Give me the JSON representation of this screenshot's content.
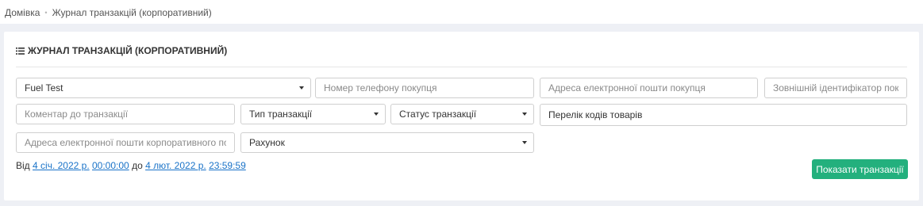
{
  "breadcrumb": {
    "home": "Домівка",
    "separator": "•",
    "current": "Журнал транзакцій (корпоративний)"
  },
  "panel": {
    "title": "ЖУРНАЛ ТРАНЗАКЦІЙ (КОРПОРАТИВНИЙ)",
    "title_icon": "list-icon"
  },
  "filters": {
    "account_select": {
      "value": "Fuel Test"
    },
    "buyer_phone": {
      "placeholder": "Номер телефону покупця",
      "value": ""
    },
    "buyer_email": {
      "placeholder": "Адреса електронної пошти покупця",
      "value": ""
    },
    "external_id": {
      "placeholder": "Зовнішній ідентифікатор покупця",
      "value": ""
    },
    "comment": {
      "placeholder": "Коментар до транзакції",
      "value": ""
    },
    "transaction_type": {
      "value": "Тип транзакції"
    },
    "transaction_status": {
      "value": "Статус транзакції"
    },
    "product_codes": {
      "value": "Перелік кодів товарів"
    },
    "corporate_email": {
      "placeholder": "Адреса електронної пошти корпоративного покупця",
      "value": ""
    },
    "invoice_select": {
      "value": "Рахунок"
    }
  },
  "date_range": {
    "from_label": "Від",
    "from_date": "4 січ. 2022 р.",
    "from_time": "00:00:00",
    "to_label": "до",
    "to_date": "4 лют. 2022 р.",
    "to_time": "23:59:59"
  },
  "actions": {
    "show_transactions": "Показати транзакції"
  },
  "colors": {
    "accent_green": "#23b07d",
    "link_blue": "#1a73c8",
    "page_bg": "#eef0f5"
  }
}
